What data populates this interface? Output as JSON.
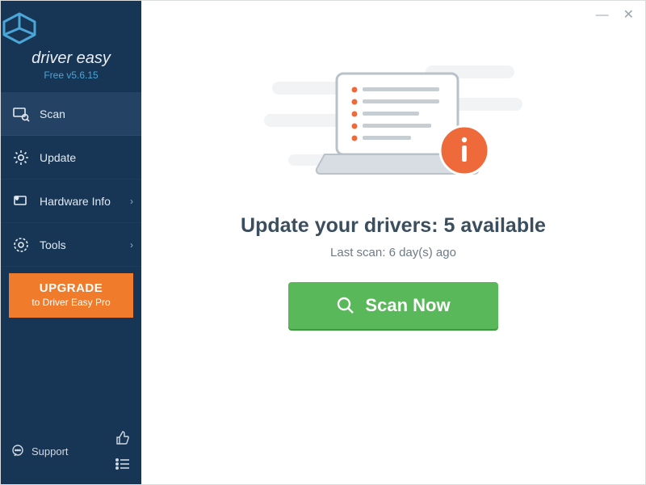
{
  "brand": {
    "name": "driver easy",
    "version": "Free v5.6.15"
  },
  "sidebar": {
    "items": [
      {
        "label": "Scan"
      },
      {
        "label": "Update"
      },
      {
        "label": "Hardware Info"
      },
      {
        "label": "Tools"
      }
    ],
    "upgrade": {
      "title": "UPGRADE",
      "sub": "to Driver Easy Pro"
    },
    "support": "Support"
  },
  "main": {
    "headline": "Update your drivers: 5 available",
    "subline": "Last scan: 6 day(s) ago",
    "scan_button": "Scan Now"
  },
  "colors": {
    "sidebar": "#173555",
    "accent": "#f07b2b",
    "scan": "#59b859"
  }
}
